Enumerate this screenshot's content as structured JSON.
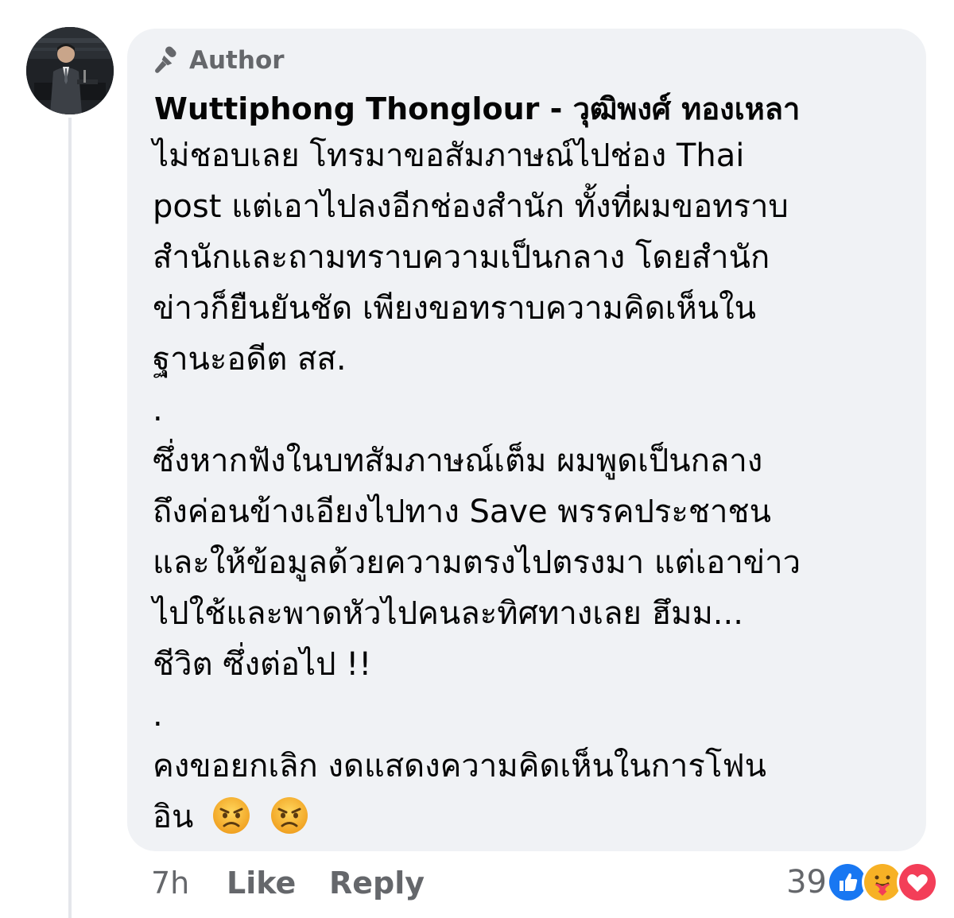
{
  "comment": {
    "badge_label": "Author",
    "author_name": "Wuttiphong Thonglour - วุฒิพงศ์ ทองเหลา",
    "body_lines": [
      "ไม่ชอบเลย โทรมาขอสัมภาษณ์ไปช่อง Thai",
      "post แต่เอาไปลงอีกช่องสำนัก ทั้งที่ผมขอทราบ",
      "สำนักและถามทราบความเป็นกลาง โดยสำนัก",
      "ข่าวก็ยืนยันชัด เพียงขอทราบความคิดเห็นใน",
      "ฐานะอดีต สส.",
      ".",
      "ซึ่งหากฟังในบทสัมภาษณ์เต็ม ผมพูดเป็นกลาง",
      "ถึงค่อนข้างเอียงไปทาง Save พรรคประชาชน",
      "และให้ข้อมูลด้วยความตรงไปตรงมา แต่เอาข่าว",
      "ไปใช้และพาดหัวไปคนละทิศทางเลย ฮึมม...",
      "ชีวิต ซึ่งต่อไป !!",
      ".",
      "คงขอยกเลิก งดแสดงความคิดเห็นในการโฟน",
      "อิน"
    ],
    "trailing_emojis": [
      "angry-face-emoji",
      "angry-face-emoji"
    ]
  },
  "footer": {
    "time": "7h",
    "like_label": "Like",
    "reply_label": "Reply",
    "reaction_count": "39",
    "reactions": [
      "like-reaction-icon",
      "care-reaction-icon",
      "love-reaction-icon"
    ]
  },
  "colors": {
    "bubble_bg": "#f0f2f5",
    "secondary_text": "#65676b",
    "like_blue": "#1877f2",
    "love_red": "#f33e58",
    "care_yellow": "#f7b125"
  }
}
